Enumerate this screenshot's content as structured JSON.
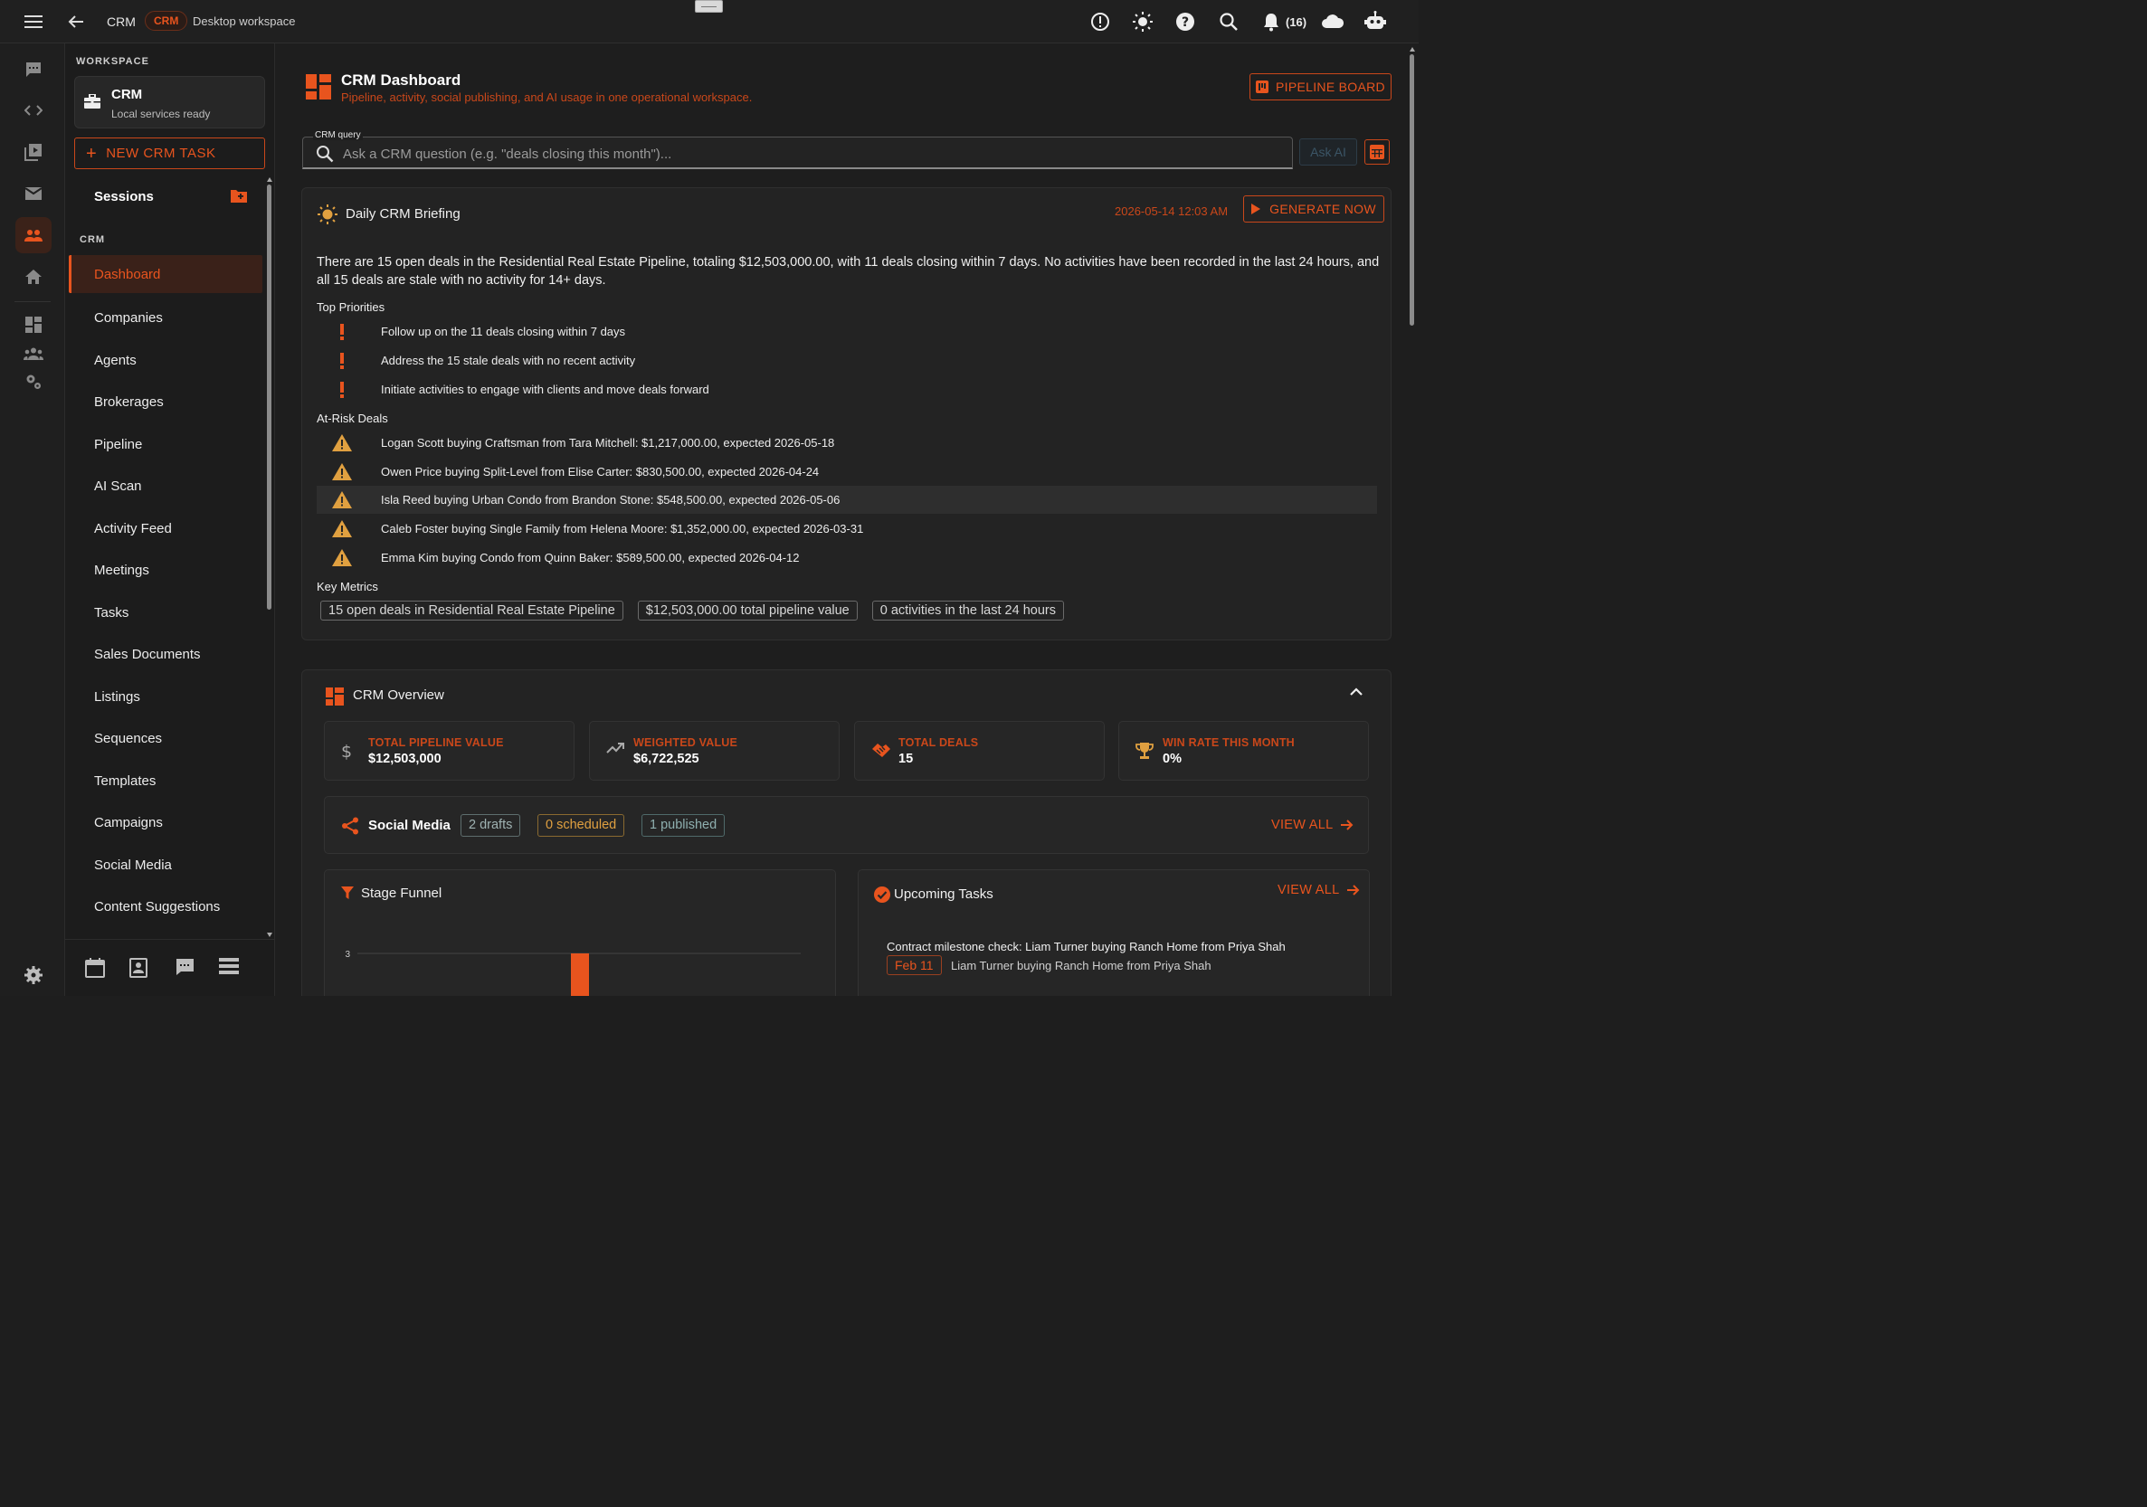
{
  "topbar": {
    "crumb_app": "CRM",
    "crumb_pill": "CRM",
    "crumb_sub": "Desktop workspace",
    "notif_count": "(16)"
  },
  "sidebar": {
    "workspace_label": "WORKSPACE",
    "workspace_title": "CRM",
    "workspace_status": "Local services ready",
    "new_task": "NEW CRM TASK",
    "sessions": "Sessions",
    "section_label": "CRM",
    "items": [
      {
        "label": "Dashboard"
      },
      {
        "label": "Companies"
      },
      {
        "label": "Agents"
      },
      {
        "label": "Brokerages"
      },
      {
        "label": "Pipeline"
      },
      {
        "label": "AI Scan"
      },
      {
        "label": "Activity Feed"
      },
      {
        "label": "Meetings"
      },
      {
        "label": "Tasks"
      },
      {
        "label": "Sales Documents"
      },
      {
        "label": "Listings"
      },
      {
        "label": "Sequences"
      },
      {
        "label": "Templates"
      },
      {
        "label": "Campaigns"
      },
      {
        "label": "Social Media"
      },
      {
        "label": "Content Suggestions"
      }
    ]
  },
  "header": {
    "title": "CRM Dashboard",
    "subtitle": "Pipeline, activity, social publishing, and AI usage in one operational workspace.",
    "pipeline_button": "PIPELINE BOARD"
  },
  "query": {
    "label": "CRM query",
    "placeholder": "Ask a CRM question (e.g. \"deals closing this month\")...",
    "ask_button": "Ask AI"
  },
  "briefing": {
    "title": "Daily CRM Briefing",
    "timestamp": "2026-05-14 12:03 AM",
    "generate_button": "GENERATE NOW",
    "summary": "There are 15 open deals in the Residential Real Estate Pipeline, totaling $12,503,000.00, with 11 deals closing within 7 days. No activities have been recorded in the last 24 hours, and all 15 deals are stale with no activity for 14+ days.",
    "priorities_label": "Top Priorities",
    "priorities": [
      "Follow up on the 11 deals closing within 7 days",
      "Address the 15 stale deals with no recent activity",
      "Initiate activities to engage with clients and move deals forward"
    ],
    "at_risk_label": "At-Risk Deals",
    "at_risk": [
      "Logan Scott buying Craftsman from Tara Mitchell: $1,217,000.00, expected 2026-05-18",
      "Owen Price buying Split-Level from Elise Carter: $830,500.00, expected 2026-04-24",
      "Isla Reed buying Urban Condo from Brandon Stone: $548,500.00, expected 2026-05-06",
      "Caleb Foster buying Single Family from Helena Moore: $1,352,000.00, expected 2026-03-31",
      "Emma Kim buying Condo from Quinn Baker: $589,500.00, expected 2026-04-12"
    ],
    "metrics_label": "Key Metrics",
    "metrics": [
      "15 open deals in Residential Real Estate Pipeline",
      "$12,503,000.00 total pipeline value",
      "0 activities in the last 24 hours"
    ]
  },
  "overview": {
    "title": "CRM Overview",
    "stats": [
      {
        "label": "TOTAL PIPELINE VALUE",
        "value": "$12,503,000"
      },
      {
        "label": "WEIGHTED VALUE",
        "value": "$6,722,525"
      },
      {
        "label": "TOTAL DEALS",
        "value": "15"
      },
      {
        "label": "WIN RATE THIS MONTH",
        "value": "0%"
      }
    ],
    "social": {
      "title": "Social Media",
      "drafts": "2 drafts",
      "scheduled": "0 scheduled",
      "published": "1 published",
      "view_all": "VIEW ALL"
    },
    "funnel": {
      "title": "Stage Funnel"
    },
    "tasks": {
      "title": "Upcoming Tasks",
      "view_all": "VIEW ALL",
      "items": [
        {
          "title": "Contract milestone check: Liam Turner buying Ranch Home from Priya Shah",
          "date": "Feb 11",
          "deal": "Liam Turner buying Ranch Home from Priya Shah"
        }
      ]
    }
  },
  "chart_data": {
    "type": "bar",
    "title": "Stage Funnel",
    "ytick_labels": [
      "3"
    ],
    "visible_bar_value": 3
  },
  "colors": {
    "accent": "#e8541e",
    "background": "#1e1e1e",
    "card": "#232323",
    "warning": "#e0a040"
  }
}
